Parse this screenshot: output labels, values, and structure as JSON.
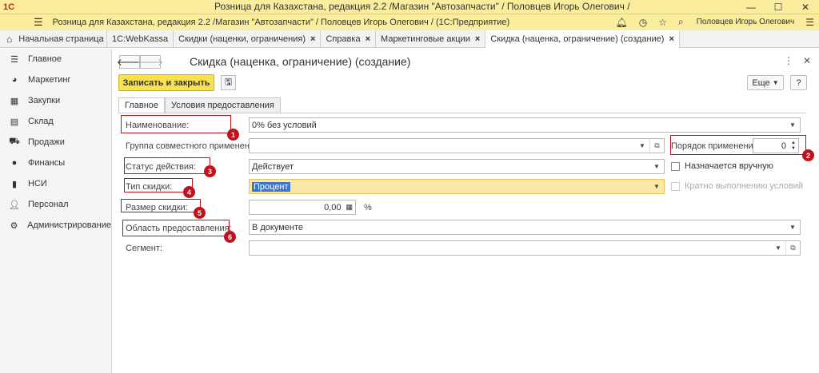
{
  "window": {
    "logo": "1С",
    "title": "Розница для Казахстана, редакция 2.2 /Магазин \"Автозапчасти\" / Половцев Игорь Олегович /"
  },
  "topbar": {
    "path": "Розница для Казахстана, редакция 2.2 /Магазин \"Автозапчасти\" / Половцев Игорь Олегович / (1С:Предприятие)",
    "user": "Половцев Игорь Олегович"
  },
  "tabs": [
    {
      "label": "Начальная страница"
    },
    {
      "label": "1С:WebKassa"
    },
    {
      "label": "Скидки (наценки, ограничения)"
    },
    {
      "label": "Справка"
    },
    {
      "label": "Маркетинговые акции"
    },
    {
      "label": "Скидка (наценка, ограничение) (создание)"
    }
  ],
  "sidebar": {
    "items": [
      {
        "label": "Главное",
        "icon": "menu-icon"
      },
      {
        "label": "Маркетинг",
        "icon": "pie-chart-icon"
      },
      {
        "label": "Закупки",
        "icon": "purchases-icon"
      },
      {
        "label": "Склад",
        "icon": "warehouse-icon"
      },
      {
        "label": "Продажи",
        "icon": "cart-icon"
      },
      {
        "label": "Финансы",
        "icon": "coins-icon"
      },
      {
        "label": "НСИ",
        "icon": "book-icon"
      },
      {
        "label": "Персонал",
        "icon": "person-icon"
      },
      {
        "label": "Администрирование",
        "icon": "gear-icon"
      }
    ]
  },
  "form": {
    "title": "Скидка (наценка, ограничение) (создание)",
    "save_close": "Записать и закрыть",
    "more": "Еще",
    "help": "?",
    "tabs": [
      "Главное",
      "Условия предоставления"
    ],
    "name_label": "Наименование:",
    "name_value": "0% без условий",
    "group_label": "Группа совместного применения:",
    "group_value": "",
    "order_label": "Порядок применения:",
    "order_value": "0",
    "status_label": "Статус действия:",
    "status_value": "Действует",
    "manual_label": "Назначается вручную",
    "type_label": "Тип скидки:",
    "type_value": "Процент",
    "multiple_label": "Кратно выполнению условий",
    "size_label": "Размер скидки:",
    "size_value": "0,00",
    "size_unit": "%",
    "area_label": "Область предоставления:",
    "area_value": "В документе",
    "segment_label": "Сегмент:",
    "segment_value": ""
  },
  "annotations": [
    "1",
    "2",
    "3",
    "4",
    "5",
    "6"
  ],
  "colors": {
    "titlebar": "#fbed9e",
    "primary_button": "#fbe150",
    "annotation_red": "#c0121c",
    "selection_blue": "#3c74d1"
  }
}
